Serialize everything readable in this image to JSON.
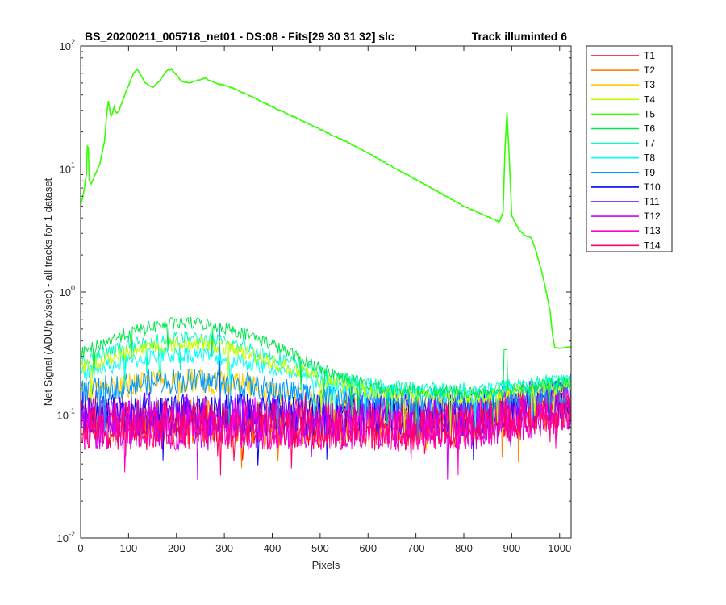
{
  "chart_data": {
    "type": "line",
    "title": "BS_20200211_005718_net01 - DS:08 - Fits[29  30  31  32]   slc",
    "subtitle": "Track illuminted 6",
    "xlabel": "Pixels",
    "ylabel": "Net Signal (ADU/pix/sec) - all tracks for 1 dataset",
    "xlim": [
      0,
      1024
    ],
    "ylim": [
      0.01,
      100
    ],
    "yscale": "log",
    "x_ticks": [
      "0",
      "100",
      "200",
      "300",
      "400",
      "500",
      "600",
      "700",
      "800",
      "900",
      "1000"
    ],
    "y_ticks": [
      {
        "base": "10",
        "exp": "-2"
      },
      {
        "base": "10",
        "exp": "-1"
      },
      {
        "base": "10",
        "exp": "0"
      },
      {
        "base": "10",
        "exp": "1"
      },
      {
        "base": "10",
        "exp": "2"
      }
    ],
    "grid": false,
    "legend_position": "outside-right",
    "series": [
      {
        "name": "T1",
        "color": "#ff0000",
        "kind": "noise",
        "base": 0.085,
        "noise": 0.22
      },
      {
        "name": "T2",
        "color": "#ff8000",
        "kind": "noise",
        "base": 0.09,
        "noise": 0.22
      },
      {
        "name": "T3",
        "color": "#ffcc00",
        "kind": "hump",
        "base": 0.11,
        "peak": 0.19,
        "noise": 0.12
      },
      {
        "name": "T4",
        "color": "#c0ff00",
        "kind": "hump",
        "base": 0.14,
        "peak": 0.38,
        "noise": 0.07
      },
      {
        "name": "T5",
        "color": "#33ff00",
        "kind": "main"
      },
      {
        "name": "T6",
        "color": "#00e64d",
        "kind": "hump",
        "base": 0.15,
        "peak": 0.56,
        "noise": 0.06
      },
      {
        "name": "T7",
        "color": "#00ffbb",
        "kind": "hump",
        "base": 0.16,
        "peak": 0.42,
        "noise": 0.07
      },
      {
        "name": "T8",
        "color": "#00ffff",
        "kind": "hump",
        "base": 0.15,
        "peak": 0.31,
        "noise": 0.08
      },
      {
        "name": "T9",
        "color": "#0099ff",
        "kind": "hump",
        "base": 0.13,
        "peak": 0.19,
        "noise": 0.12
      },
      {
        "name": "T10",
        "color": "#0000ff",
        "kind": "noise",
        "base": 0.1,
        "noise": 0.2
      },
      {
        "name": "T11",
        "color": "#6600ff",
        "kind": "noise",
        "base": 0.1,
        "noise": 0.22
      },
      {
        "name": "T12",
        "color": "#cc00ff",
        "kind": "noise",
        "base": 0.085,
        "noise": 0.25
      },
      {
        "name": "T13",
        "color": "#ff00cc",
        "kind": "noise",
        "base": 0.08,
        "noise": 0.22
      },
      {
        "name": "T14",
        "color": "#ff0066",
        "kind": "noise",
        "base": 0.08,
        "noise": 0.22
      }
    ],
    "main_profile": {
      "x": [
        0,
        5,
        12,
        15,
        18,
        22,
        30,
        40,
        50,
        55,
        58,
        62,
        65,
        70,
        75,
        80,
        90,
        100,
        110,
        118,
        125,
        135,
        150,
        165,
        180,
        190,
        200,
        210,
        225,
        240,
        260,
        280,
        300,
        320,
        350,
        400,
        450,
        500,
        550,
        600,
        650,
        700,
        750,
        800,
        850,
        875,
        882,
        886,
        890,
        895,
        900,
        915,
        930,
        940,
        950,
        960,
        970,
        980,
        985,
        990,
        1000,
        1024
      ],
      "y": [
        5,
        6,
        9,
        20,
        8,
        7.5,
        9,
        11,
        17,
        30,
        36,
        28,
        27,
        32,
        28,
        30,
        38,
        48,
        60,
        65,
        58,
        50,
        46,
        52,
        63,
        65,
        58,
        52,
        50,
        52,
        55,
        50,
        48,
        45,
        40,
        32,
        26,
        21,
        17,
        13.5,
        10.5,
        8.2,
        6.4,
        5,
        4.1,
        3.7,
        4.5,
        15,
        29,
        12,
        4.2,
        3.2,
        2.85,
        2.8,
        2.2,
        1.6,
        1.1,
        0.7,
        0.45,
        0.35,
        0.35,
        0.36
      ]
    }
  }
}
